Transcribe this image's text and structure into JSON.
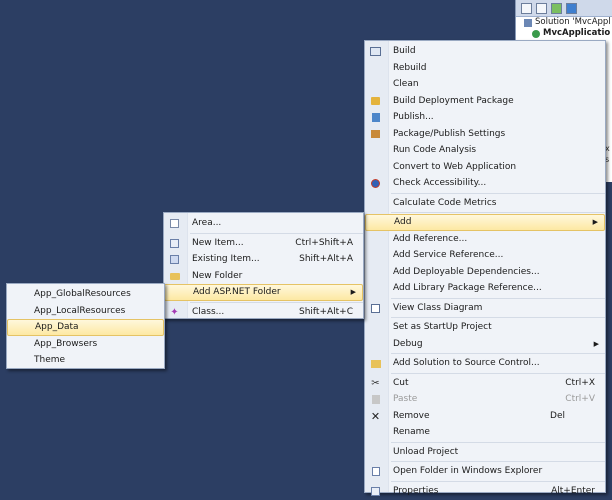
{
  "solution_explorer": {
    "row1": "Solution 'MvcAppl",
    "row2": "MvcApplicatio",
    "frag_x": "x",
    "frag_s": "s"
  },
  "context_menu": {
    "build": "Build",
    "rebuild": "Rebuild",
    "clean": "Clean",
    "build_deploy": "Build Deployment Package",
    "publish": "Publish...",
    "pkg_settings": "Package/Publish Settings",
    "code_analysis": "Run Code Analysis",
    "convert_web": "Convert to Web Application",
    "check_access": "Check Accessibility...",
    "calc_metrics": "Calculate Code Metrics",
    "add": "Add",
    "add_reference": "Add Reference...",
    "add_service_ref": "Add Service Reference...",
    "add_deploy_dep": "Add Deployable Dependencies...",
    "add_lib_pkg_ref": "Add Library Package Reference...",
    "view_class_diagram": "View Class Diagram",
    "set_startup": "Set as StartUp Project",
    "debug": "Debug",
    "add_solution_src": "Add Solution to Source Control...",
    "cut": "Cut",
    "cut_sc": "Ctrl+X",
    "paste": "Paste",
    "paste_sc": "Ctrl+V",
    "remove": "Remove",
    "remove_sc": "Del",
    "rename": "Rename",
    "unload": "Unload Project",
    "open_folder": "Open Folder in Windows Explorer",
    "properties": "Properties",
    "properties_sc": "Alt+Enter"
  },
  "add_submenu": {
    "area": "Area...",
    "new_item": "New Item...",
    "new_item_sc": "Ctrl+Shift+A",
    "existing_item": "Existing Item...",
    "existing_item_sc": "Shift+Alt+A",
    "new_folder": "New Folder",
    "asp_folder": "Add ASP.NET Folder",
    "class": "Class...",
    "class_sc": "Shift+Alt+C"
  },
  "asp_folder_submenu": {
    "items": [
      "App_GlobalResources",
      "App_LocalResources",
      "App_Data",
      "App_Browsers",
      "Theme"
    ]
  },
  "colors": {
    "desktop_bg": "#2c3e63",
    "menu_bg": "#f0f3f8",
    "highlight": "#fde9a3"
  }
}
